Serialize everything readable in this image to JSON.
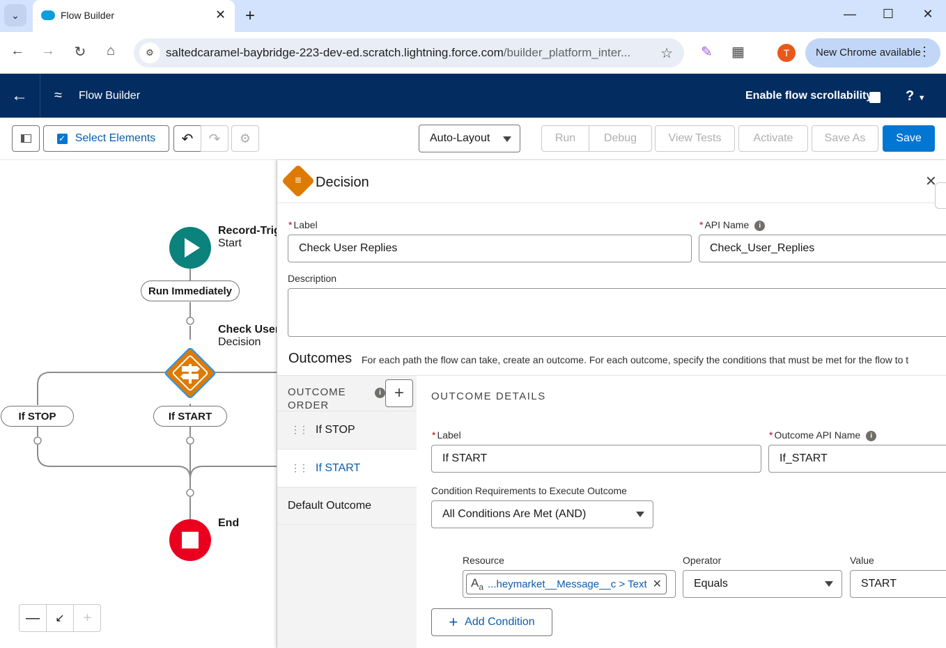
{
  "browser": {
    "tab_title": "Flow Builder",
    "url_host": "saltedcaramel-baybridge-223-dev-ed.scratch.lightning.force.com",
    "url_path": "/builder_platform_inter...",
    "profile_initial": "T",
    "update_label": "New Chrome available"
  },
  "header": {
    "app_title": "Flow Builder",
    "scroll_label": "Enable flow scrollability",
    "help_label": "?"
  },
  "toolbar": {
    "select_elements": "Select Elements",
    "layout_value": "Auto-Layout",
    "run": "Run",
    "debug": "Debug",
    "view_tests": "View Tests",
    "activate": "Activate",
    "save_as": "Save As",
    "save": "Save"
  },
  "canvas": {
    "start": {
      "title": "Record-Trig",
      "subtitle": "Start"
    },
    "run_immediately": "Run Immediately",
    "decision": {
      "title": "Check User",
      "subtitle": "Decision"
    },
    "branch_stop": "If STOP",
    "branch_start": "If START",
    "end": "End"
  },
  "panel": {
    "type": "Decision",
    "label_caption": "Label",
    "label_value": "Check User Replies",
    "api_caption": "API Name",
    "api_value": "Check_User_Replies",
    "description_caption": "Description",
    "description_value": "",
    "outcomes_title": "Outcomes",
    "outcomes_help": "For each path the flow can take, create an outcome. For each outcome, specify the conditions that must be met for the flow to t",
    "outcome_order_l1": "OUTCOME",
    "outcome_order_l2": "ORDER",
    "outcomes": [
      "If STOP",
      "If START"
    ],
    "default_outcome": "Default Outcome",
    "details_title": "OUTCOME DETAILS",
    "out_label_caption": "Label",
    "out_label_value": "If START",
    "out_api_caption": "Outcome API Name",
    "out_api_value": "If_START",
    "cond_req_caption": "Condition Requirements to Execute Outcome",
    "cond_req_value": "All Conditions Are Met (AND)",
    "resource_caption": "Resource",
    "resource_value": "...heymarket__Message__c > Text",
    "operator_caption": "Operator",
    "operator_value": "Equals",
    "value_caption": "Value",
    "value_value": "START",
    "add_condition": "Add Condition"
  },
  "colors": {
    "header_bg": "#032d60",
    "brand": "#0176d3",
    "start_node": "#0b827c",
    "decision_node": "#dd7a01",
    "end_node": "#ea001e"
  }
}
